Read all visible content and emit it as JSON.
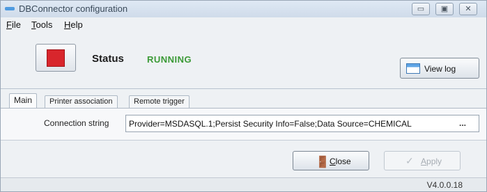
{
  "window": {
    "title": "DBConnector configuration",
    "controls": {
      "minimize": "▭",
      "maximize": "▣",
      "close": "✕"
    }
  },
  "menu": {
    "file": {
      "mnemonic": "F",
      "rest": "ile"
    },
    "tools": {
      "mnemonic": "T",
      "rest": "ools"
    },
    "help": {
      "mnemonic": "H",
      "rest": "elp"
    }
  },
  "status": {
    "label": "Status",
    "value": "RUNNING",
    "value_color": "#3b9a36",
    "stop_color": "#d8262c",
    "view_log_label": "View log"
  },
  "tabs": [
    {
      "label": "Main",
      "active": true
    },
    {
      "label": "Printer association",
      "active": false
    },
    {
      "label": "Remote trigger",
      "active": false
    }
  ],
  "main_tab": {
    "connection_label": "Connection string",
    "connection_value": "Provider=MSDASQL.1;Persist Security Info=False;Data Source=CHEMICAL",
    "browse_label": "..."
  },
  "buttons": {
    "close": {
      "mnemonic": "C",
      "rest": "lose",
      "icon": "door-icon"
    },
    "apply": {
      "mnemonic": "A",
      "rest": "pply",
      "icon": "check-icon",
      "enabled": false
    }
  },
  "footer": {
    "version": "V4.0.0.18"
  }
}
